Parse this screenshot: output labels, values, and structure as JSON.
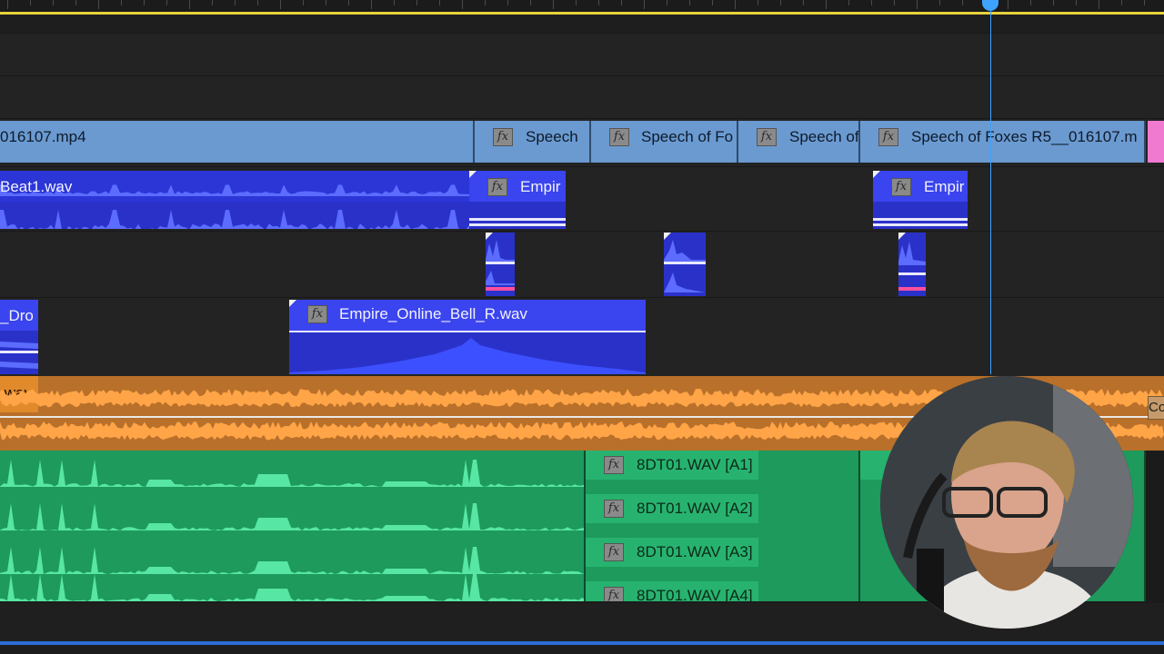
{
  "colors": {
    "video_clip": "#6b9ad0",
    "audio_clip_blue": "#2a31c9",
    "audio_clip_orange": "#b8702a",
    "audio_clip_green": "#1d9a5c",
    "playhead": "#3ea3ff",
    "work_area": "#e6d23c"
  },
  "video_track": {
    "clips": [
      {
        "label": "016107.mp4"
      },
      {
        "label": "Speech",
        "fx": "fx"
      },
      {
        "label": "Speech of Fo",
        "fx": "fx"
      },
      {
        "label": "Speech of",
        "fx": "fx"
      },
      {
        "label": "Speech of Foxes R5__016107.m",
        "fx": "fx"
      }
    ]
  },
  "audio_tracks": {
    "a1": [
      {
        "label": "Beat1.wav"
      },
      {
        "label": "Empir",
        "fx": "fx"
      },
      {
        "label": "Empir",
        "fx": "fx"
      }
    ],
    "a3": [
      {
        "label": "_Dro"
      },
      {
        "label": "Empire_Online_Bell_R.wav",
        "fx": "fx"
      }
    ],
    "a4": {
      "label": ".wav",
      "edge_label": "Co"
    },
    "a5": [
      {
        "label": "8DT01.WAV [A1]",
        "fx": "fx"
      },
      {
        "label": "8DT01.WAV [A2]",
        "fx": "fx"
      },
      {
        "label": "8DT01.WAV [A3]",
        "fx": "fx"
      },
      {
        "label": "8DT01.WAV [A4]",
        "fx": "fx"
      }
    ]
  },
  "webcam": {
    "icon": "person-avatar-icon"
  }
}
